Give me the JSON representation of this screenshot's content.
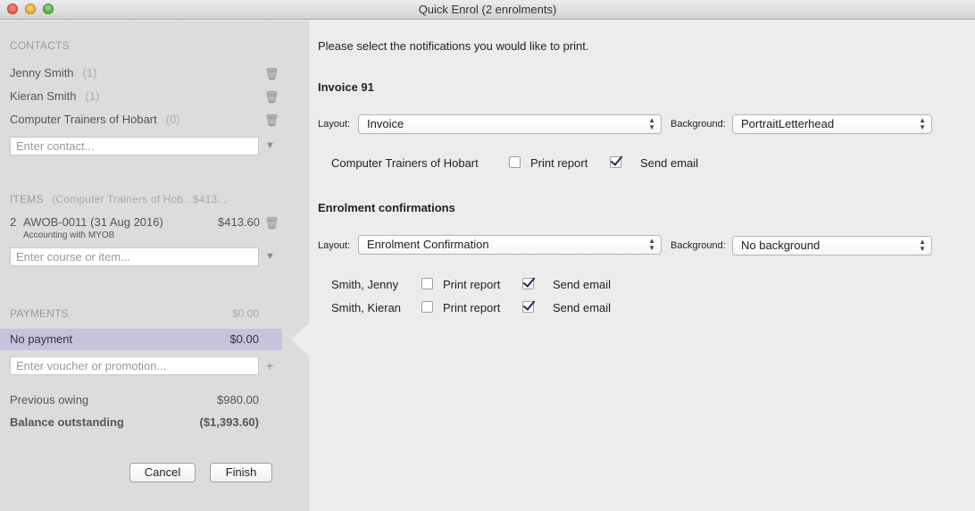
{
  "window": {
    "title": "Quick Enrol (2 enrolments)"
  },
  "sidebar": {
    "contacts": {
      "heading": "CONTACTS",
      "items": [
        {
          "name": "Jenny Smith",
          "count": "(1)"
        },
        {
          "name": "Kieran Smith",
          "count": "(1)"
        },
        {
          "name": "Computer Trainers of Hobart",
          "count": "(0)"
        }
      ],
      "input_placeholder": "Enter contact..."
    },
    "items": {
      "heading": "ITEMS",
      "subheading": "(Computer Trainers of Hob...$413...",
      "rows": [
        {
          "qty": "2",
          "title": "AWOB-0011 (31 Aug 2016)",
          "subtitle": "Accounting with MYOB",
          "price": "$413.60"
        }
      ],
      "input_placeholder": "Enter course or item..."
    },
    "payments": {
      "heading": "PAYMENTS",
      "total": "$0.00",
      "selected_label": "No payment",
      "selected_amount": "$0.00",
      "voucher_placeholder": "Enter voucher or promotion..."
    },
    "totals": {
      "previous_label": "Previous owing",
      "previous_value": "$980.00",
      "balance_label": "Balance outstanding",
      "balance_value": "($1,393.60)"
    },
    "buttons": {
      "cancel": "Cancel",
      "finish": "Finish"
    }
  },
  "main": {
    "intro": "Please select the notifications you would like to print.",
    "invoice": {
      "heading": "Invoice 91",
      "layout_label": "Layout:",
      "layout_value": "Invoice",
      "background_label": "Background:",
      "background_value": "PortraitLetterhead",
      "recipients": [
        {
          "name": "Computer Trainers of Hobart",
          "print_label": "Print report",
          "print": false,
          "email_label": "Send email",
          "email": true
        }
      ]
    },
    "confirmations": {
      "heading": "Enrolment confirmations",
      "layout_label": "Layout:",
      "layout_value": "Enrolment Confirmation",
      "background_label": "Background:",
      "background_value": "No background",
      "recipients": [
        {
          "name": "Smith, Jenny",
          "print_label": "Print report",
          "print": false,
          "email_label": "Send email",
          "email": true
        },
        {
          "name": "Smith, Kieran",
          "print_label": "Print report",
          "print": false,
          "email_label": "Send email",
          "email": true
        }
      ]
    }
  }
}
